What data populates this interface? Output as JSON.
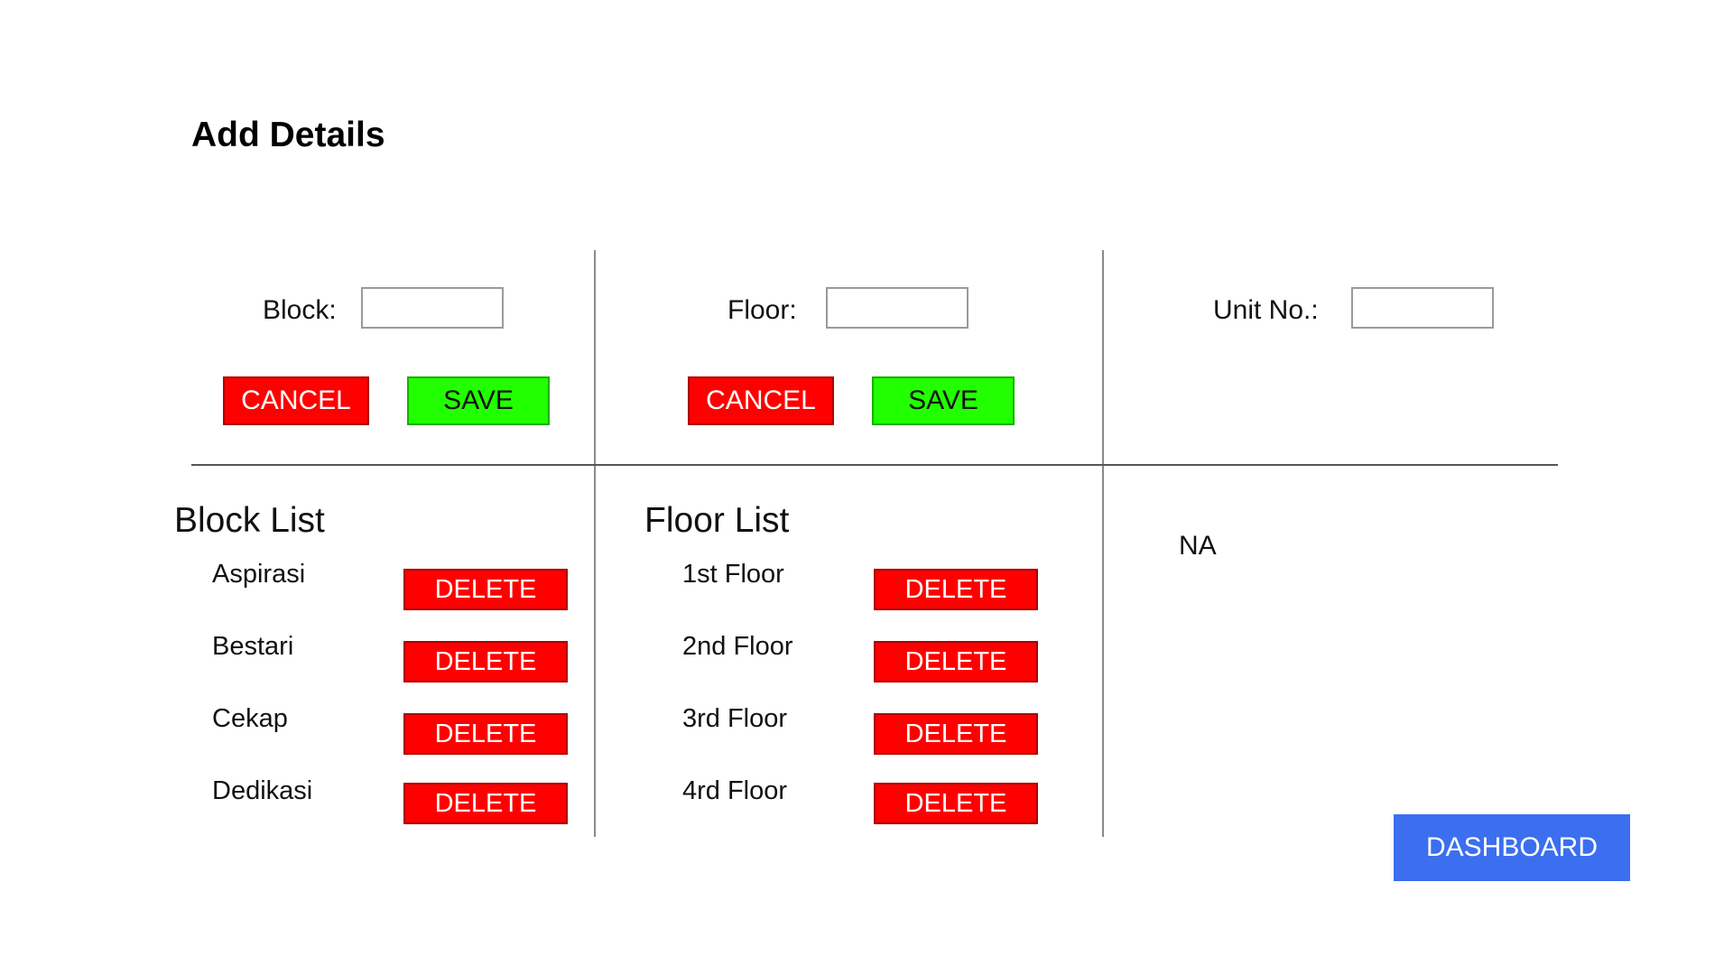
{
  "page": {
    "title": "Add Details"
  },
  "block_form": {
    "label": "Block:",
    "value": "",
    "cancel_label": "CANCEL",
    "save_label": "SAVE"
  },
  "floor_form": {
    "label": "Floor:",
    "value": "",
    "cancel_label": "CANCEL",
    "save_label": "SAVE"
  },
  "unit_form": {
    "label": "Unit No.:",
    "value": ""
  },
  "block_list": {
    "title": "Block List",
    "delete_label": "DELETE",
    "items": [
      "Aspirasi",
      "Bestari",
      "Cekap",
      "Dedikasi"
    ]
  },
  "floor_list": {
    "title": "Floor List",
    "delete_label": "DELETE",
    "items": [
      "1st Floor",
      "2nd Floor",
      "3rd Floor",
      "4rd Floor"
    ]
  },
  "unit_list": {
    "empty_text": "NA"
  },
  "dashboard_button": {
    "label": "DASHBOARD"
  },
  "colors": {
    "cancel": "#ff0000",
    "save": "#22ff00",
    "delete": "#ff0000",
    "dashboard": "#3b6ff0"
  }
}
